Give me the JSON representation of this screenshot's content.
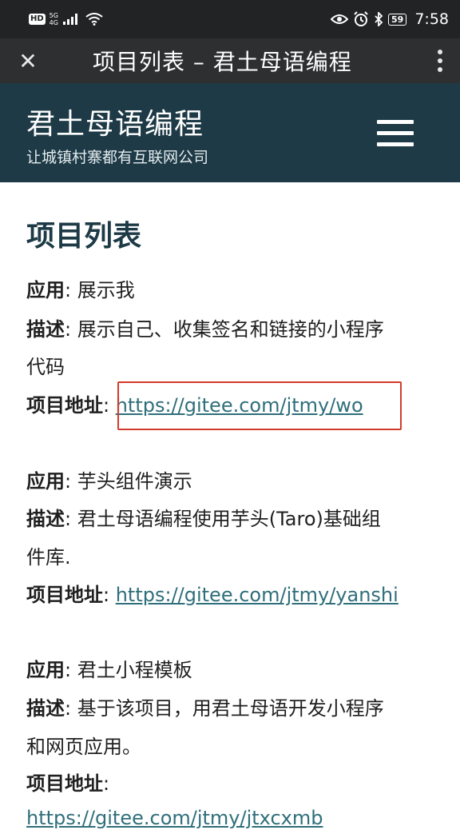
{
  "status_bar": {
    "hd": "HD",
    "network": "5G",
    "network_sub": "4G",
    "battery": "59",
    "time": "7:58"
  },
  "browser": {
    "close_symbol": "✕",
    "title": "项目列表 – 君土母语编程"
  },
  "site": {
    "title": "君土母语编程",
    "subtitle": "让城镇村寨都有互联网公司"
  },
  "page": {
    "heading": "项目列表",
    "projects": [
      {
        "app_label": "应用",
        "app_name": "展示我",
        "desc_label": "描述",
        "desc_line1": "展示自己、收集签名和链接的小程序",
        "desc_line2": "代码",
        "url_label": "项目地址",
        "url": "https://gitee.com/jtmy/wo"
      },
      {
        "app_label": "应用",
        "app_name": "芋头组件演示",
        "desc_label": "描述",
        "desc_line1": "君土母语编程使用芋头(Taro)基础组",
        "desc_line2": "件库.",
        "url_label": "项目地址",
        "url": "https://gitee.com/jtmy/yanshi"
      },
      {
        "app_label": "应用",
        "app_name": "君土小程模板",
        "desc_label": "描述",
        "desc_line1": "基于该项目，用君土母语开发小程序",
        "desc_line2": "和网页应用。",
        "url_label": "项目地址",
        "url": "https://gitee.com/jtmy/jtxcxmb"
      }
    ]
  },
  "colors": {
    "header_bg": "#1d3a46",
    "link": "#2f6f7a",
    "highlight": "#d23b2a"
  },
  "icons": [
    "close-icon",
    "more-vert-icon",
    "hamburger-menu-icon",
    "wifi-icon",
    "signal-icon",
    "eye-icon",
    "alarm-icon",
    "bluetooth-icon",
    "battery-icon"
  ]
}
